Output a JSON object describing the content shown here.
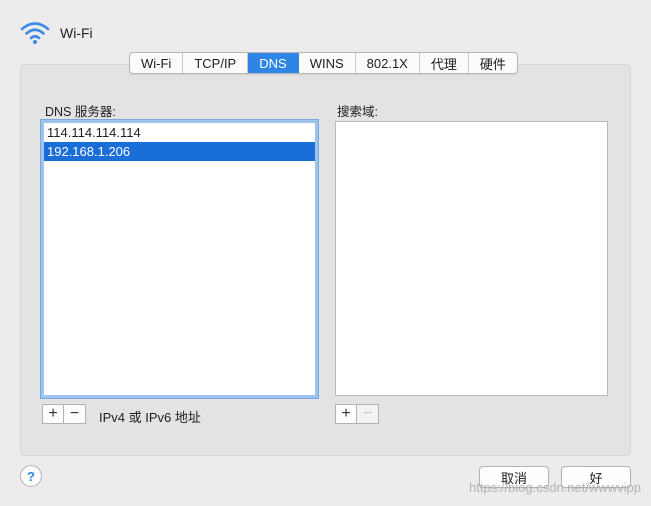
{
  "header": {
    "title": "Wi-Fi",
    "icon": "wifi-icon"
  },
  "tabs": [
    {
      "label": "Wi-Fi",
      "active": false
    },
    {
      "label": "TCP/IP",
      "active": false
    },
    {
      "label": "DNS",
      "active": true
    },
    {
      "label": "WINS",
      "active": false
    },
    {
      "label": "802.1X",
      "active": false
    },
    {
      "label": "代理",
      "active": false
    },
    {
      "label": "硬件",
      "active": false
    }
  ],
  "dns": {
    "label": "DNS 服务器:",
    "servers": [
      "114.114.114.114",
      "192.168.1.206"
    ],
    "selected_index": 1,
    "add_label": "+",
    "remove_label": "−",
    "hint": "IPv4 或 IPv6 地址"
  },
  "search": {
    "label": "搜索域:",
    "domains": [],
    "add_label": "+",
    "remove_label": "−"
  },
  "footer": {
    "help_label": "?",
    "cancel_label": "取消",
    "ok_label": "好"
  },
  "watermark": "https://blog.csdn.net/wwwvipp",
  "colors": {
    "accent": "#2e85e6",
    "selection": "#1a6ed8"
  }
}
